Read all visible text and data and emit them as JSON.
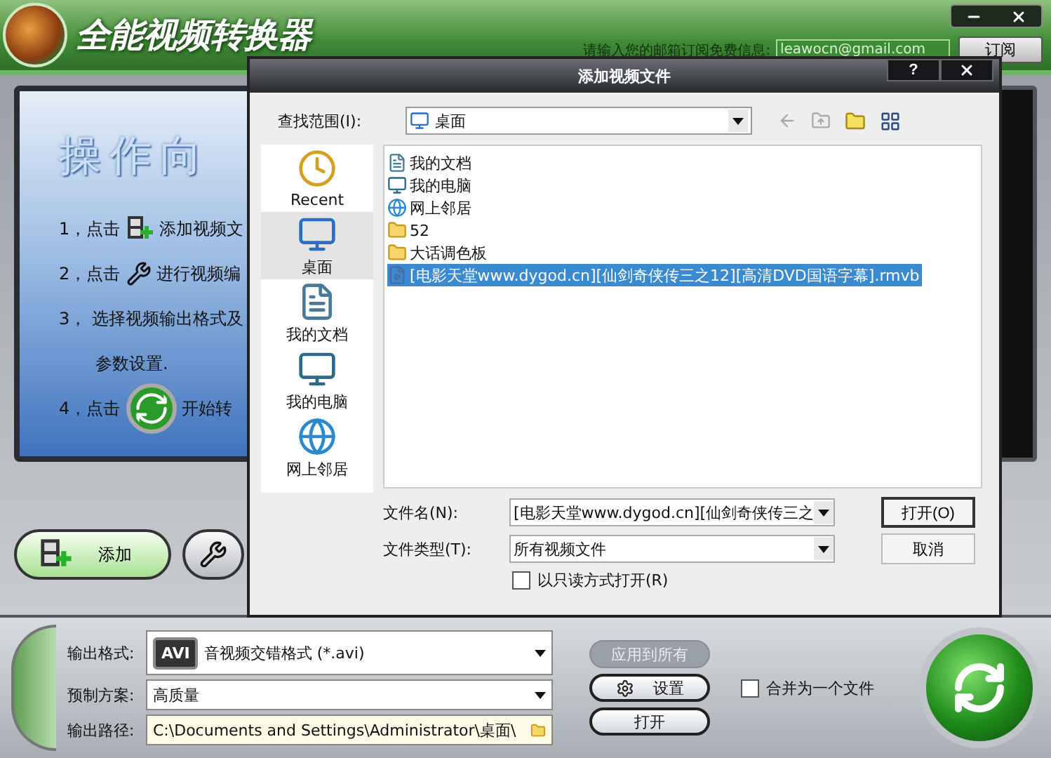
{
  "app": {
    "title": "全能视频转换器",
    "email_prompt": "请输入您的邮箱订阅免费信息:",
    "email_value": "leawocn@gmail.com",
    "subscribe_button": "订阅"
  },
  "wizard": {
    "title": "操作向",
    "steps": [
      {
        "kind": "add",
        "prefix": "1，点击",
        "text": "添加视频文"
      },
      {
        "kind": "tools",
        "prefix": "2，点击",
        "text": "进行视频编"
      },
      {
        "kind": "plain",
        "prefix": "3，",
        "text": "选择视频输出格式及"
      },
      {
        "kind": "plain",
        "text": "参数设置."
      },
      {
        "kind": "start",
        "prefix": "4，点击",
        "text": "开始转"
      }
    ]
  },
  "add_button": "添加",
  "bottom": {
    "format_label": "输出格式:",
    "format_badge": "AVI",
    "format_value": "音视频交错格式 (*.avi)",
    "preset_label": "预制方案:",
    "preset_value": "高质量",
    "path_label": "输出路径:",
    "path_value": "C:\\Documents and Settings\\Administrator\\桌面\\",
    "apply_button": {
      "label": "应用到所有",
      "disabled": true
    },
    "settings_button": "设置",
    "open_button": "打开",
    "merge": {
      "label": "合并为一个文件",
      "checked": false
    }
  },
  "dialog": {
    "title": "添加视频文件",
    "help_button": "?",
    "look_in": {
      "label": "查找范围(I):",
      "value": "桌面"
    },
    "places": [
      {
        "kind": "recent",
        "label": "Recent",
        "selected": false
      },
      {
        "kind": "desktop",
        "label": "桌面",
        "selected": true
      },
      {
        "kind": "documents",
        "label": "我的文档",
        "selected": false
      },
      {
        "kind": "computer",
        "label": "我的电脑",
        "selected": false
      },
      {
        "kind": "network",
        "label": "网上邻居",
        "selected": false
      }
    ],
    "files": [
      {
        "kind": "documents",
        "name": "我的文档",
        "selected": false
      },
      {
        "kind": "computer",
        "name": "我的电脑",
        "selected": false
      },
      {
        "kind": "network",
        "name": "网上邻居",
        "selected": false
      },
      {
        "kind": "folder",
        "name": "52",
        "selected": false
      },
      {
        "kind": "folder",
        "name": "大话调色板",
        "selected": false
      },
      {
        "kind": "video",
        "name": "[电影天堂www.dygod.cn][仙剑奇侠传三之12][高清DVD国语字幕].rmvb",
        "selected": true
      }
    ],
    "file_name": {
      "label": "文件名(N):",
      "value": "[电影天堂www.dygod.cn][仙剑奇侠传三之"
    },
    "file_type": {
      "label": "文件类型(T):",
      "value": "所有视频文件"
    },
    "readonly": {
      "label": "以只读方式打开(R)",
      "checked": false
    },
    "open_button": "打开(O)",
    "cancel_button": "取消"
  }
}
